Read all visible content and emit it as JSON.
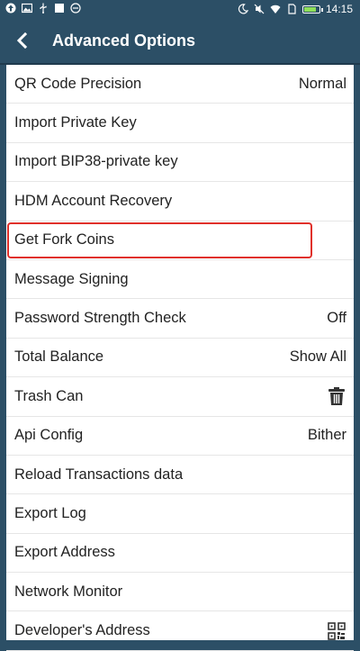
{
  "status_bar": {
    "time": "14:15",
    "icons_left": [
      "upload-icon",
      "image-icon",
      "usb-icon",
      "square-icon",
      "dnd-icon"
    ],
    "icons_right": [
      "moon-icon",
      "mute-icon",
      "wifi-icon",
      "sim-icon",
      "battery-icon"
    ]
  },
  "header": {
    "title": "Advanced Options",
    "back_icon": "chevron-left-icon"
  },
  "colors": {
    "header_bg": "#2c4f66",
    "highlight": "#e0302a",
    "battery": "#8ee05a"
  },
  "rows": [
    {
      "label": "QR Code Precision",
      "value": "Normal"
    },
    {
      "label": "Import Private Key",
      "value": ""
    },
    {
      "label": "Import BIP38-private key",
      "value": ""
    },
    {
      "label": "HDM Account Recovery",
      "value": ""
    },
    {
      "label": "Get Fork Coins",
      "value": "",
      "highlighted": true
    },
    {
      "label": "Message Signing",
      "value": ""
    },
    {
      "label": "Password Strength Check",
      "value": "Off"
    },
    {
      "label": "Total Balance",
      "value": "Show All"
    },
    {
      "label": "Trash Can",
      "value": "",
      "icon": "trash-icon"
    },
    {
      "label": "Api Config",
      "value": "Bither"
    },
    {
      "label": "Reload Transactions data",
      "value": ""
    },
    {
      "label": "Export Log",
      "value": ""
    },
    {
      "label": "Export Address",
      "value": ""
    },
    {
      "label": "Network Monitor",
      "value": ""
    },
    {
      "label": "Developer's Address",
      "value": "",
      "icon": "qr-code-icon"
    }
  ]
}
